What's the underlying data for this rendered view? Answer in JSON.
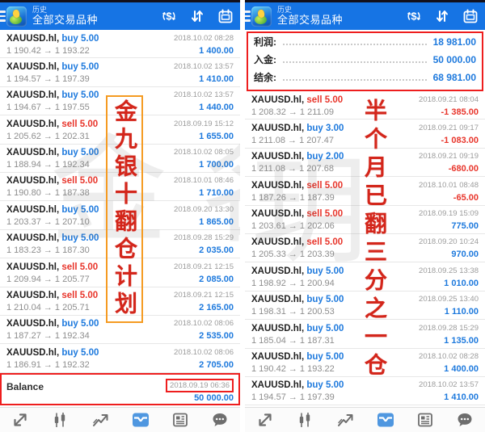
{
  "colors": {
    "header_blue": "#1674e4",
    "buy_blue": "#1d79dd",
    "sell_red": "#e8352b",
    "profit_positive": "#1d79dd",
    "profit_negative": "#e8352b",
    "annotation_red": "#ee1e1e",
    "annotation_orange": "#f59b22",
    "calligraphy_red": "#d3261b"
  },
  "header": {
    "title_small": "历史",
    "title_main": "全部交易品种",
    "icons": [
      {
        "name": "currency-exchange-icon"
      },
      {
        "name": "sort-icon"
      },
      {
        "name": "calendar-icon"
      }
    ]
  },
  "left_panel": {
    "overlay_text": "金九银十翻仓计划",
    "watermarks": [
      "金",
      "名"
    ],
    "trades": [
      {
        "symbol": "XAUUSD.hl,",
        "side": "buy",
        "volume": "5.00",
        "open": "1 190.42",
        "close": "1 193.22",
        "datetime": "2018.10.02 08:28",
        "profit": "1 400.00"
      },
      {
        "symbol": "XAUUSD.hl,",
        "side": "buy",
        "volume": "5.00",
        "open": "1 194.57",
        "close": "1 197.39",
        "datetime": "2018.10.02 13:57",
        "profit": "1 410.00"
      },
      {
        "symbol": "XAUUSD.hl,",
        "side": "buy",
        "volume": "5.00",
        "open": "1 194.67",
        "close": "1 197.55",
        "datetime": "2018.10.02 13:57",
        "profit": "1 440.00"
      },
      {
        "symbol": "XAUUSD.hl,",
        "side": "sell",
        "volume": "5.00",
        "open": "1 205.62",
        "close": "1 202.31",
        "datetime": "2018.09.19 15:12",
        "profit": "1 655.00"
      },
      {
        "symbol": "XAUUSD.hl,",
        "side": "buy",
        "volume": "5.00",
        "open": "1 188.94",
        "close": "1 192.34",
        "datetime": "2018.10.02 08:05",
        "profit": "1 700.00"
      },
      {
        "symbol": "XAUUSD.hl,",
        "side": "sell",
        "volume": "5.00",
        "open": "1 190.80",
        "close": "1 187.38",
        "datetime": "2018.10.01 08:46",
        "profit": "1 710.00"
      },
      {
        "symbol": "XAUUSD.hl,",
        "side": "buy",
        "volume": "5.00",
        "open": "1 203.37",
        "close": "1 207.10",
        "datetime": "2018.09.20 13:30",
        "profit": "1 865.00"
      },
      {
        "symbol": "XAUUSD.hl,",
        "side": "buy",
        "volume": "5.00",
        "open": "1 183.23",
        "close": "1 187.30",
        "datetime": "2018.09.28 15:29",
        "profit": "2 035.00"
      },
      {
        "symbol": "XAUUSD.hl,",
        "side": "sell",
        "volume": "5.00",
        "open": "1 209.94",
        "close": "1 205.77",
        "datetime": "2018.09.21 12:15",
        "profit": "2 085.00"
      },
      {
        "symbol": "XAUUSD.hl,",
        "side": "sell",
        "volume": "5.00",
        "open": "1 210.04",
        "close": "1 205.71",
        "datetime": "2018.09.21 12:15",
        "profit": "2 165.00"
      },
      {
        "symbol": "XAUUSD.hl,",
        "side": "buy",
        "volume": "5.00",
        "open": "1 187.27",
        "close": "1 192.34",
        "datetime": "2018.10.02 08:06",
        "profit": "2 535.00"
      },
      {
        "symbol": "XAUUSD.hl,",
        "side": "buy",
        "volume": "5.00",
        "open": "1 186.91",
        "close": "1 192.32",
        "datetime": "2018.10.02 08:06",
        "profit": "2 705.00"
      }
    ],
    "balance": {
      "label": "Balance",
      "datetime": "2018.09.19 06:36",
      "amount": "50 000.00"
    }
  },
  "right_panel": {
    "overlay_text": "半个月已翻三分之一仓",
    "watermarks": [
      "玥"
    ],
    "summary": [
      {
        "label": "利润:",
        "value": "18 981.00"
      },
      {
        "label": "入金:",
        "value": "50 000.00"
      },
      {
        "label": "结余:",
        "value": "68 981.00"
      }
    ],
    "trades": [
      {
        "symbol": "XAUUSD.hl,",
        "side": "sell",
        "volume": "5.00",
        "open": "1 208.32",
        "close": "1 211.09",
        "datetime": "2018.09.21 08:04",
        "profit": "-1 385.00"
      },
      {
        "symbol": "XAUUSD.hl,",
        "side": "buy",
        "volume": "3.00",
        "open": "1 211.08",
        "close": "1 207.47",
        "datetime": "2018.09.21 09:17",
        "profit": "-1 083.00"
      },
      {
        "symbol": "XAUUSD.hl,",
        "side": "buy",
        "volume": "2.00",
        "open": "1 211.08",
        "close": "1 207.68",
        "datetime": "2018.09.21 09:19",
        "profit": "-680.00"
      },
      {
        "symbol": "XAUUSD.hl,",
        "side": "sell",
        "volume": "5.00",
        "open": "1 187.26",
        "close": "1 187.39",
        "datetime": "2018.10.01 08:48",
        "profit": "-65.00"
      },
      {
        "symbol": "XAUUSD.hl,",
        "side": "sell",
        "volume": "5.00",
        "open": "1 203.61",
        "close": "1 202.06",
        "datetime": "2018.09.19 15:09",
        "profit": "775.00"
      },
      {
        "symbol": "XAUUSD.hl,",
        "side": "sell",
        "volume": "5.00",
        "open": "1 205.33",
        "close": "1 203.39",
        "datetime": "2018.09.20 10:24",
        "profit": "970.00"
      },
      {
        "symbol": "XAUUSD.hl,",
        "side": "buy",
        "volume": "5.00",
        "open": "1 198.92",
        "close": "1 200.94",
        "datetime": "2018.09.25 13:38",
        "profit": "1 010.00"
      },
      {
        "symbol": "XAUUSD.hl,",
        "side": "buy",
        "volume": "5.00",
        "open": "1 198.31",
        "close": "1 200.53",
        "datetime": "2018.09.25 13:40",
        "profit": "1 110.00"
      },
      {
        "symbol": "XAUUSD.hl,",
        "side": "buy",
        "volume": "5.00",
        "open": "1 185.04",
        "close": "1 187.31",
        "datetime": "2018.09.28 15:29",
        "profit": "1 135.00"
      },
      {
        "symbol": "XAUUSD.hl,",
        "side": "buy",
        "volume": "5.00",
        "open": "1 190.42",
        "close": "1 193.22",
        "datetime": "2018.10.02 08:28",
        "profit": "1 400.00"
      },
      {
        "symbol": "XAUUSD.hl,",
        "side": "buy",
        "volume": "5.00",
        "open": "1 194.57",
        "close": "1 197.39",
        "datetime": "2018.10.02 13:57",
        "profit": "1 410.00"
      }
    ]
  },
  "toolbar": {
    "items": [
      {
        "name": "quotes-icon"
      },
      {
        "name": "charts-icon"
      },
      {
        "name": "trade-icon"
      },
      {
        "name": "history-icon",
        "active": true
      },
      {
        "name": "news-icon"
      },
      {
        "name": "messages-icon"
      }
    ]
  }
}
